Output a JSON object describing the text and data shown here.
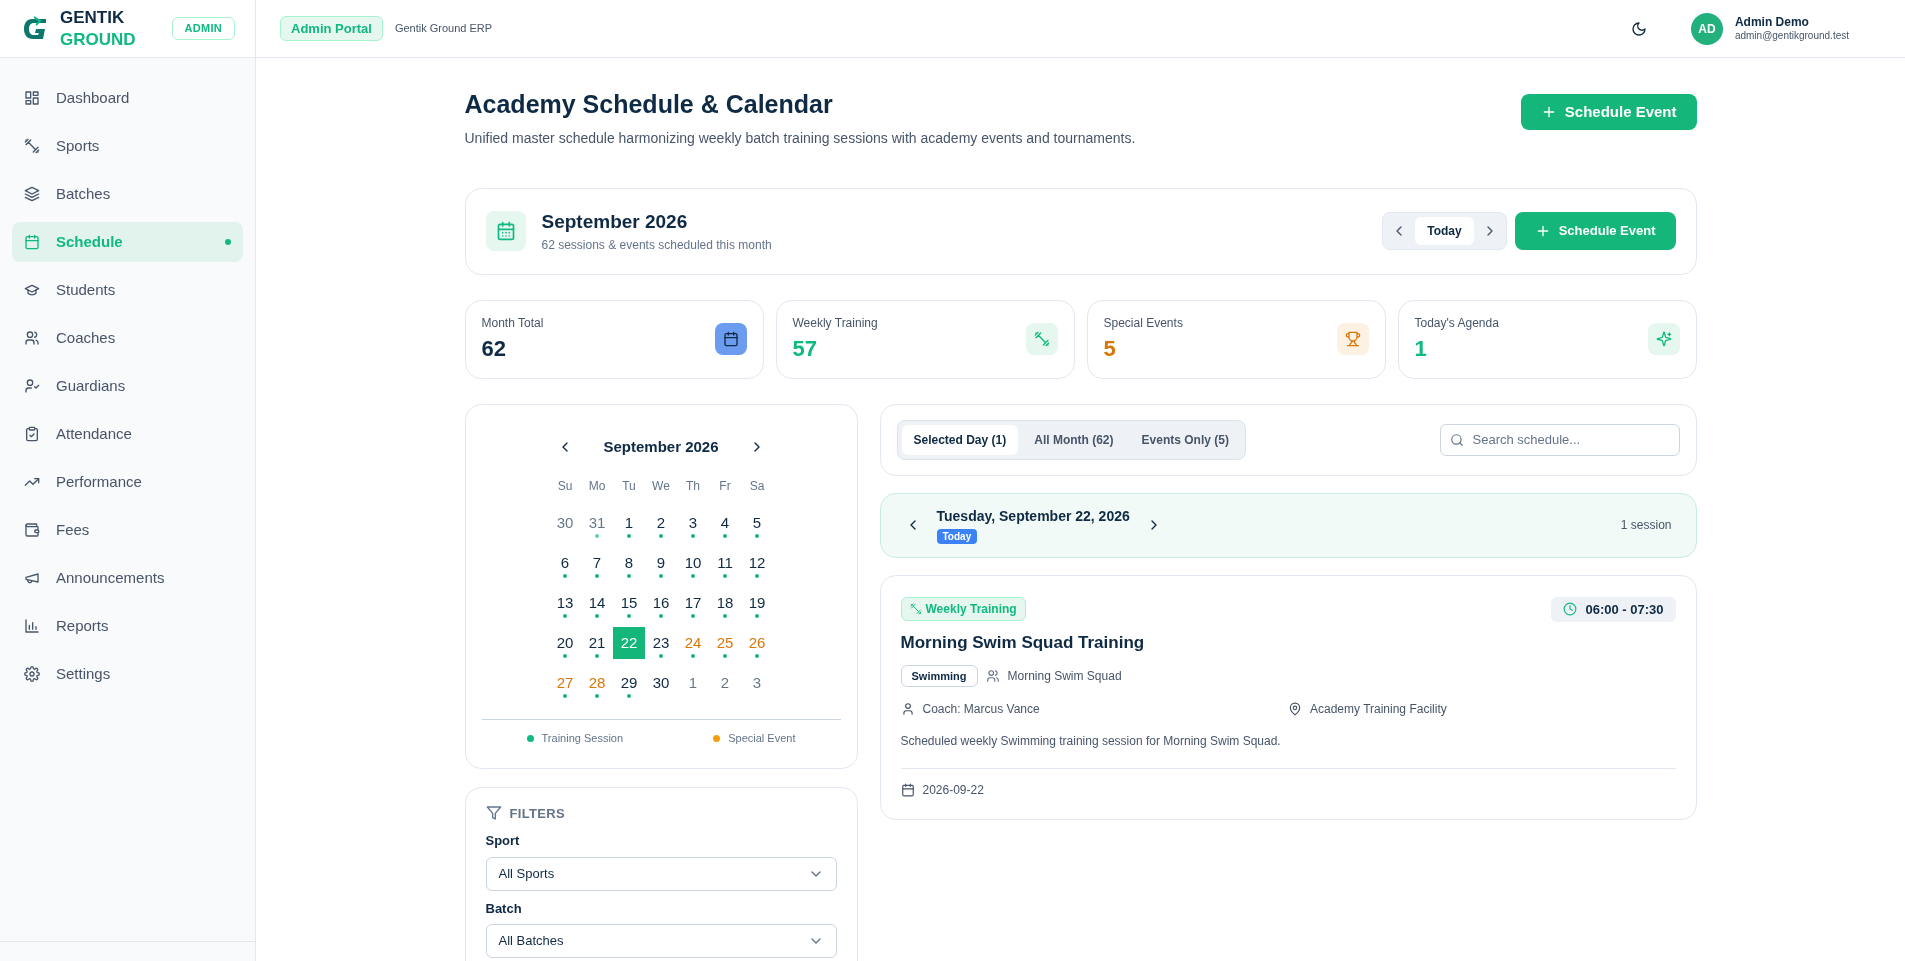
{
  "brand": {
    "line1": "GENTIK",
    "line2": "GROUND",
    "badge": "ADMIN"
  },
  "header": {
    "portal": "Admin Portal",
    "app": "Gentik Ground ERP",
    "user": {
      "initials": "AD",
      "name": "Admin Demo",
      "email": "admin@gentikground.test"
    }
  },
  "sidebar": {
    "items": [
      {
        "label": "Dashboard",
        "selected": false
      },
      {
        "label": "Sports",
        "selected": false
      },
      {
        "label": "Batches",
        "selected": false
      },
      {
        "label": "Schedule",
        "selected": true
      },
      {
        "label": "Students",
        "selected": false
      },
      {
        "label": "Coaches",
        "selected": false
      },
      {
        "label": "Guardians",
        "selected": false
      },
      {
        "label": "Attendance",
        "selected": false
      },
      {
        "label": "Performance",
        "selected": false
      },
      {
        "label": "Fees",
        "selected": false
      },
      {
        "label": "Announcements",
        "selected": false
      },
      {
        "label": "Reports",
        "selected": false
      },
      {
        "label": "Settings",
        "selected": false
      }
    ]
  },
  "page": {
    "title": "Academy Schedule & Calendar",
    "subtitle": "Unified master schedule harmonizing weekly batch training sessions with academy events and tournaments.",
    "action": "Schedule Event"
  },
  "month_bar": {
    "title": "September 2026",
    "subtitle": "62 sessions & events scheduled this month",
    "today": "Today",
    "action": "Schedule Event"
  },
  "stats": [
    {
      "label": "Month Total",
      "value": "62",
      "kind": "total"
    },
    {
      "label": "Weekly Training",
      "value": "57",
      "kind": "training"
    },
    {
      "label": "Special Events",
      "value": "5",
      "kind": "events"
    },
    {
      "label": "Today's Agenda",
      "value": "1",
      "kind": "agenda"
    }
  ],
  "calendar": {
    "title": "September 2026",
    "weekdays": [
      "Su",
      "Mo",
      "Tu",
      "We",
      "Th",
      "Fr",
      "Sa"
    ],
    "days": [
      {
        "label": "30",
        "outside": true,
        "dot": false,
        "special": false,
        "selected": false
      },
      {
        "label": "31",
        "outside": true,
        "dot": true,
        "special": false,
        "selected": false
      },
      {
        "label": "1",
        "outside": false,
        "dot": true,
        "special": false,
        "selected": false
      },
      {
        "label": "2",
        "outside": false,
        "dot": true,
        "special": false,
        "selected": false
      },
      {
        "label": "3",
        "outside": false,
        "dot": true,
        "special": false,
        "selected": false
      },
      {
        "label": "4",
        "outside": false,
        "dot": true,
        "special": false,
        "selected": false
      },
      {
        "label": "5",
        "outside": false,
        "dot": true,
        "special": false,
        "selected": false
      },
      {
        "label": "6",
        "outside": false,
        "dot": true,
        "special": false,
        "selected": false
      },
      {
        "label": "7",
        "outside": false,
        "dot": true,
        "special": false,
        "selected": false
      },
      {
        "label": "8",
        "outside": false,
        "dot": true,
        "special": false,
        "selected": false
      },
      {
        "label": "9",
        "outside": false,
        "dot": true,
        "special": false,
        "selected": false
      },
      {
        "label": "10",
        "outside": false,
        "dot": true,
        "special": false,
        "selected": false
      },
      {
        "label": "11",
        "outside": false,
        "dot": true,
        "special": false,
        "selected": false
      },
      {
        "label": "12",
        "outside": false,
        "dot": true,
        "special": false,
        "selected": false
      },
      {
        "label": "13",
        "outside": false,
        "dot": true,
        "special": false,
        "selected": false
      },
      {
        "label": "14",
        "outside": false,
        "dot": true,
        "special": false,
        "selected": false
      },
      {
        "label": "15",
        "outside": false,
        "dot": true,
        "special": false,
        "selected": false
      },
      {
        "label": "16",
        "outside": false,
        "dot": true,
        "special": false,
        "selected": false
      },
      {
        "label": "17",
        "outside": false,
        "dot": true,
        "special": false,
        "selected": false
      },
      {
        "label": "18",
        "outside": false,
        "dot": true,
        "special": false,
        "selected": false
      },
      {
        "label": "19",
        "outside": false,
        "dot": true,
        "special": false,
        "selected": false
      },
      {
        "label": "20",
        "outside": false,
        "dot": true,
        "special": false,
        "selected": false
      },
      {
        "label": "21",
        "outside": false,
        "dot": true,
        "special": false,
        "selected": false
      },
      {
        "label": "22",
        "outside": false,
        "dot": true,
        "special": false,
        "selected": true
      },
      {
        "label": "23",
        "outside": false,
        "dot": true,
        "special": false,
        "selected": false
      },
      {
        "label": "24",
        "outside": false,
        "dot": true,
        "special": true,
        "selected": false
      },
      {
        "label": "25",
        "outside": false,
        "dot": true,
        "special": true,
        "selected": false
      },
      {
        "label": "26",
        "outside": false,
        "dot": true,
        "special": true,
        "selected": false
      },
      {
        "label": "27",
        "outside": false,
        "dot": true,
        "special": true,
        "selected": false
      },
      {
        "label": "28",
        "outside": false,
        "dot": true,
        "special": true,
        "selected": false
      },
      {
        "label": "29",
        "outside": false,
        "dot": true,
        "special": false,
        "selected": false
      },
      {
        "label": "30",
        "outside": false,
        "dot": false,
        "special": false,
        "selected": false
      },
      {
        "label": "1",
        "outside": true,
        "dot": false,
        "special": false,
        "selected": false
      },
      {
        "label": "2",
        "outside": true,
        "dot": false,
        "special": false,
        "selected": false
      },
      {
        "label": "3",
        "outside": true,
        "dot": false,
        "special": false,
        "selected": false
      }
    ],
    "legend": [
      {
        "label": "Training Session",
        "color": "#10b981"
      },
      {
        "label": "Special Event",
        "color": "#f59e0b"
      }
    ]
  },
  "filters": {
    "title": "FILTERS",
    "fields": [
      {
        "label": "Sport",
        "value": "All Sports"
      },
      {
        "label": "Batch",
        "value": "All Batches"
      }
    ]
  },
  "tabs": [
    {
      "label": "Selected Day (1)",
      "selected": true
    },
    {
      "label": "All Month (62)",
      "selected": false
    },
    {
      "label": "Events Only (5)",
      "selected": false
    }
  ],
  "search": {
    "placeholder": "Search schedule..."
  },
  "day": {
    "title": "Tuesday, September 22, 2026",
    "badge": "Today",
    "count": "1 session"
  },
  "events": [
    {
      "type": "Weekly Training",
      "time": "06:00 - 07:30",
      "title": "Morning Swim Squad Training",
      "sport": "Swimming",
      "batch": "Morning Swim Squad",
      "coach": "Coach: Marcus Vance",
      "location": "Academy Training Facility",
      "description": "Scheduled weekly Swimming training session for Morning Swim Squad.",
      "date": "2026-09-22"
    }
  ]
}
